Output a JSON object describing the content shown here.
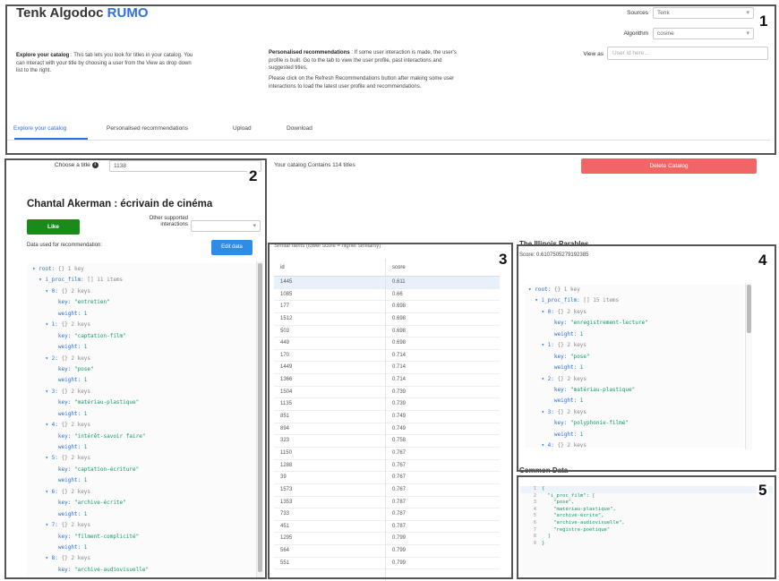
{
  "app": {
    "title_main": "Tenk Algodoc",
    "title_brand": "RUMO"
  },
  "header": {
    "sources_label": "Sources",
    "sources_value": "Tenk",
    "algorithm_label": "Algorithm",
    "algorithm_value": "cosine",
    "view_as_label": "View as",
    "view_as_placeholder": "User id here...",
    "explore_desc_title": "Explore your catalog",
    "explore_desc_text": " : This tab lets you look for titles in your catalog. You can interact with your title by choosing a user from the View as drop down list to the right.",
    "reco_desc_title": "Personalised recommendations",
    "reco_desc_text": " : If some user interaction is made, the user's profile is built. Go to the tab to view the user profile, past interactions and suggested titles.",
    "reco_desc_text2": "Please click on the Refresh Recommendations button after making some user interactions to load the latest user profile and recommendations."
  },
  "tabs": [
    "Explore your catalog",
    "Personalised recommendations",
    "Upload",
    "Download"
  ],
  "badges": [
    "1",
    "2",
    "3",
    "4",
    "5"
  ],
  "left_panel": {
    "choose_label": "Choose a title",
    "choose_value": "1138",
    "doc_title": "Chantal Akerman : écrivain de cinéma",
    "like_label": "Like",
    "other_label": "Other supported interactions",
    "data_used_label": "Data used for recommendation:",
    "edit_label": "Edit data",
    "json_lines": [
      [
        "▾ root: ",
        "{} 1 key",
        ""
      ],
      [
        "  ▾ i_proc_film: ",
        "[] 11 items",
        ""
      ],
      [
        "    ▾ 0: ",
        "{} 2 keys",
        ""
      ],
      [
        "        key: ",
        "",
        "\"entretien\""
      ],
      [
        "        weight: ",
        "",
        "1"
      ],
      [
        "    ▾ 1: ",
        "{} 2 keys",
        ""
      ],
      [
        "        key: ",
        "",
        "\"captation-film\""
      ],
      [
        "        weight: ",
        "",
        "1"
      ],
      [
        "    ▾ 2: ",
        "{} 2 keys",
        ""
      ],
      [
        "        key: ",
        "",
        "\"pose\""
      ],
      [
        "        weight: ",
        "",
        "1"
      ],
      [
        "    ▾ 3: ",
        "{} 2 keys",
        ""
      ],
      [
        "        key: ",
        "",
        "\"matériau-plastique\""
      ],
      [
        "        weight: ",
        "",
        "1"
      ],
      [
        "    ▾ 4: ",
        "{} 2 keys",
        ""
      ],
      [
        "        key: ",
        "",
        "\"intérêt-savoir faire\""
      ],
      [
        "        weight: ",
        "",
        "1"
      ],
      [
        "    ▾ 5: ",
        "{} 2 keys",
        ""
      ],
      [
        "        key: ",
        "",
        "\"captation-écriture\""
      ],
      [
        "        weight: ",
        "",
        "1"
      ],
      [
        "    ▾ 6: ",
        "{} 2 keys",
        ""
      ],
      [
        "        key: ",
        "",
        "\"archive-écrite\""
      ],
      [
        "        weight: ",
        "",
        "1"
      ],
      [
        "    ▾ 7: ",
        "{} 2 keys",
        ""
      ],
      [
        "        key: ",
        "",
        "\"filment-complicité\""
      ],
      [
        "        weight: ",
        "",
        "1"
      ],
      [
        "    ▾ 8: ",
        "{} 2 keys",
        ""
      ],
      [
        "        key: ",
        "",
        "\"archive-audiovisuelle\""
      ]
    ]
  },
  "catalog": {
    "count_text": "Your catalog Contains 114 titles",
    "delete_label": "Delete Catalog",
    "similar_note": "Similar items (lower score = higher similarity)"
  },
  "table": {
    "headers": [
      "id",
      "score"
    ],
    "rows": [
      [
        "1445",
        "0.611"
      ],
      [
        "1085",
        "0.66"
      ],
      [
        "177",
        "0.698"
      ],
      [
        "1512",
        "0.698"
      ],
      [
        "503",
        "0.698"
      ],
      [
        "449",
        "0.698"
      ],
      [
        "170",
        "0.714"
      ],
      [
        "1449",
        "0.714"
      ],
      [
        "1366",
        "0.714"
      ],
      [
        "1504",
        "0.739"
      ],
      [
        "1135",
        "0.739"
      ],
      [
        "851",
        "0.749"
      ],
      [
        "894",
        "0.749"
      ],
      [
        "323",
        "0.758"
      ],
      [
        "1150",
        "0.767"
      ],
      [
        "1288",
        "0.767"
      ],
      [
        "39",
        "0.767"
      ],
      [
        "1573",
        "0.767"
      ],
      [
        "1353",
        "0.787"
      ],
      [
        "733",
        "0.787"
      ],
      [
        "451",
        "0.787"
      ],
      [
        "1295",
        "0.799"
      ],
      [
        "564",
        "0.799"
      ],
      [
        "551",
        "0.799"
      ]
    ]
  },
  "similar_panel": {
    "title": "The Illinois Parables",
    "score_text": "Score: 0.6107505279192385",
    "json_lines": [
      [
        "▾ root: ",
        "{} 1 key",
        ""
      ],
      [
        "  ▾ i_proc_film: ",
        "[] 15 items",
        ""
      ],
      [
        "    ▾ 0: ",
        "{} 2 keys",
        ""
      ],
      [
        "        key: ",
        "",
        "\"enregistrement-lecture\""
      ],
      [
        "        weight: ",
        "",
        "1"
      ],
      [
        "    ▾ 1: ",
        "{} 2 keys",
        ""
      ],
      [
        "        key: ",
        "",
        "\"pose\""
      ],
      [
        "        weight: ",
        "",
        "1"
      ],
      [
        "    ▾ 2: ",
        "{} 2 keys",
        ""
      ],
      [
        "        key: ",
        "",
        "\"matériau-plastique\""
      ],
      [
        "        weight: ",
        "",
        "1"
      ],
      [
        "    ▾ 3: ",
        "{} 2 keys",
        ""
      ],
      [
        "        key: ",
        "",
        "\"polyphonie-filmé\""
      ],
      [
        "        weight: ",
        "",
        "1"
      ],
      [
        "    ▾ 4: ",
        "{} 2 keys",
        ""
      ]
    ]
  },
  "common_panel": {
    "title": "Common Data",
    "code_lines": [
      [
        "1",
        "{"
      ],
      [
        "2",
        "  \"i_proc_film\": ["
      ],
      [
        "3",
        "    \"pose\","
      ],
      [
        "4",
        "    \"matériau-plastique\","
      ],
      [
        "5",
        "    \"archive-écrite\","
      ],
      [
        "6",
        "    \"archive-audiovisuelle\","
      ],
      [
        "7",
        "    \"registre-poétique\""
      ],
      [
        "8",
        "  ]"
      ],
      [
        "9",
        "}"
      ]
    ]
  }
}
